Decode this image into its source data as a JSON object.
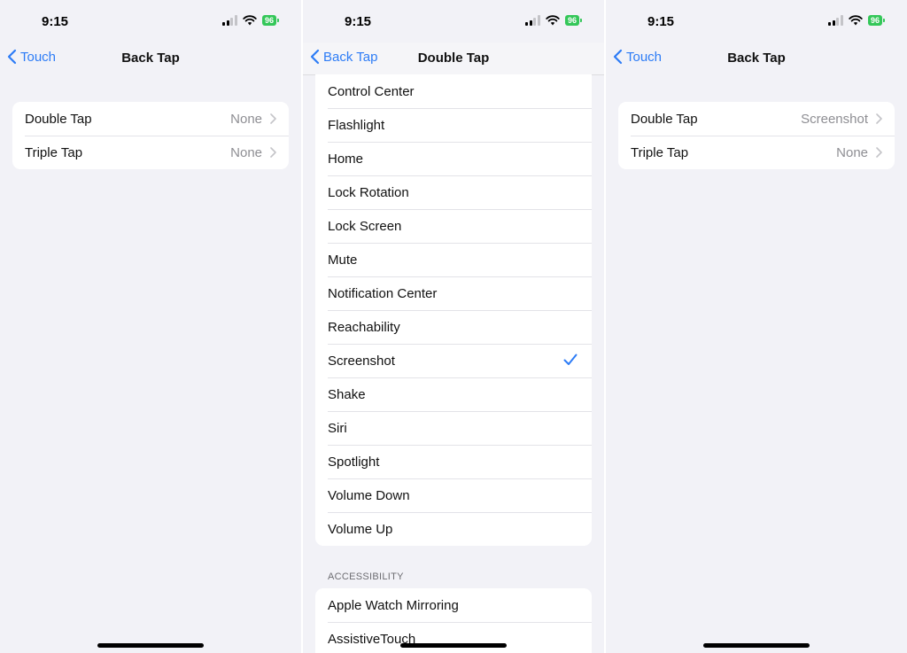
{
  "status_bar": {
    "time": "9:15",
    "battery": "96"
  },
  "screen1": {
    "back_label": "Touch",
    "title": "Back Tap",
    "rows": [
      {
        "label": "Double Tap",
        "value": "None"
      },
      {
        "label": "Triple Tap",
        "value": "None"
      }
    ]
  },
  "screen2": {
    "back_label": "Back Tap",
    "title": "Double Tap",
    "options": [
      "Control Center",
      "Flashlight",
      "Home",
      "Lock Rotation",
      "Lock Screen",
      "Mute",
      "Notification Center",
      "Reachability",
      "Screenshot",
      "Shake",
      "Siri",
      "Spotlight",
      "Volume Down",
      "Volume Up"
    ],
    "selected": "Screenshot",
    "accessibility_header": "ACCESSIBILITY",
    "accessibility_options": [
      "Apple Watch Mirroring",
      "AssistiveTouch"
    ]
  },
  "screen3": {
    "back_label": "Touch",
    "title": "Back Tap",
    "rows": [
      {
        "label": "Double Tap",
        "value": "Screenshot"
      },
      {
        "label": "Triple Tap",
        "value": "None"
      }
    ]
  },
  "colors": {
    "accent": "#2d7cf6",
    "battery": "#34c759",
    "background": "#f2f2f7"
  },
  "icons": [
    "chevron-left-icon",
    "chevron-right-icon",
    "checkmark-icon",
    "signal-icon",
    "wifi-icon",
    "battery-icon"
  ]
}
